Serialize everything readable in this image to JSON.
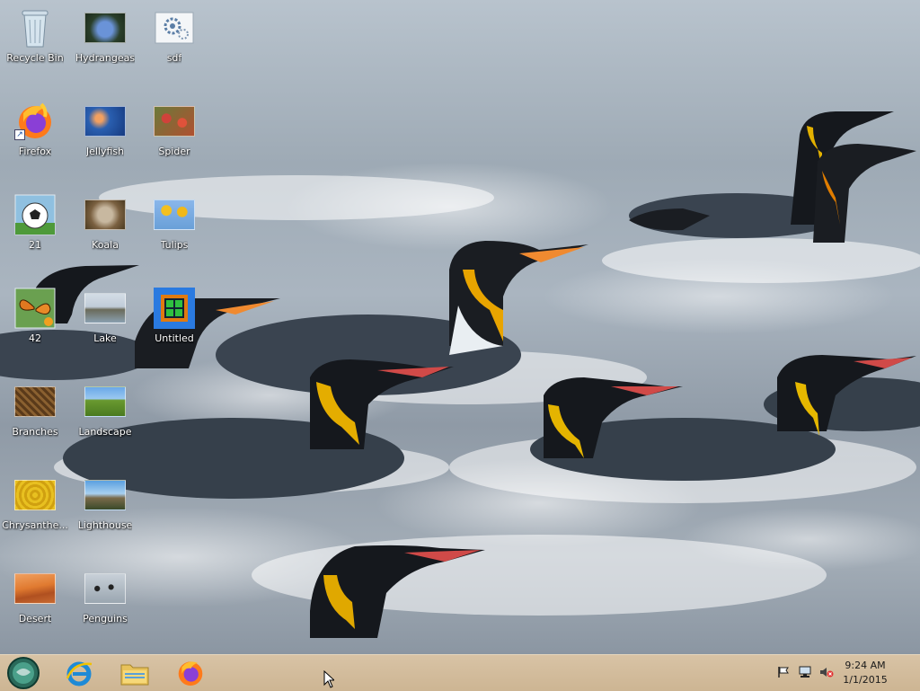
{
  "desktop": {
    "icons": [
      {
        "label": "Recycle Bin",
        "icon": "recycle-bin-icon"
      },
      {
        "label": "Hydrangeas",
        "icon": "image-thumbnail"
      },
      {
        "label": "sdf",
        "icon": "settings-file-icon"
      },
      {
        "label": "Firefox",
        "icon": "firefox-icon"
      },
      {
        "label": "Jellyfish",
        "icon": "image-thumbnail"
      },
      {
        "label": "Spider",
        "icon": "image-thumbnail"
      },
      {
        "label": "21",
        "icon": "soccer-ball-image"
      },
      {
        "label": "Koala",
        "icon": "image-thumbnail"
      },
      {
        "label": "Tulips",
        "icon": "image-thumbnail"
      },
      {
        "label": "42",
        "icon": "butterfly-image"
      },
      {
        "label": "Lake",
        "icon": "image-thumbnail"
      },
      {
        "label": "Untitled",
        "icon": "app-icon"
      },
      {
        "label": "Branches",
        "icon": "image-thumbnail"
      },
      {
        "label": "Landscape",
        "icon": "image-thumbnail"
      },
      {
        "label": "Chrysanthe...",
        "icon": "image-thumbnail"
      },
      {
        "label": "Lighthouse",
        "icon": "image-thumbnail"
      },
      {
        "label": "Desert",
        "icon": "image-thumbnail"
      },
      {
        "label": "Penguins",
        "icon": "image-thumbnail"
      }
    ]
  },
  "taskbar": {
    "pinned": [
      {
        "name": "start-button",
        "icon": "start-orb-icon"
      },
      {
        "name": "internet-explorer-button",
        "icon": "internet-explorer-icon"
      },
      {
        "name": "file-explorer-button",
        "icon": "folder-icon"
      },
      {
        "name": "firefox-taskbar-button",
        "icon": "firefox-icon"
      }
    ],
    "tray": {
      "icons": [
        "flag-icon",
        "network-icon",
        "volume-muted-icon"
      ],
      "time": "9:24 AM",
      "date": "1/1/2015"
    }
  },
  "colors": {
    "taskbar": "#d1ba99",
    "firefox_orange": "#ff7a1a",
    "ie_blue": "#1e8ad6"
  }
}
